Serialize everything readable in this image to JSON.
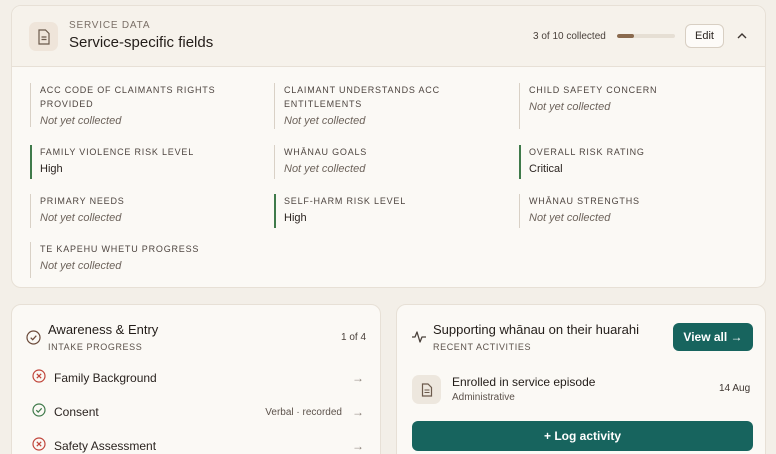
{
  "service_data": {
    "eyebrow": "SERVICE DATA",
    "title": "Service-specific fields",
    "progress_text": "3 of 10 collected",
    "progress_fraction": 0.3,
    "edit_label": "Edit",
    "fields": [
      {
        "label": "ACC CODE OF CLAIMANTS RIGHTS PROVIDED",
        "value": "Not yet collected"
      },
      {
        "label": "CLAIMANT UNDERSTANDS ACC ENTITLEMENTS",
        "value": "Not yet collected"
      },
      {
        "label": "CHILD SAFETY CONCERN",
        "value": "Not yet collected"
      },
      {
        "label": "FAMILY VIOLENCE RISK LEVEL",
        "value": "High"
      },
      {
        "label": "WHĀNAU GOALS",
        "value": "Not yet collected"
      },
      {
        "label": "OVERALL RISK RATING",
        "value": "Critical"
      },
      {
        "label": "PRIMARY NEEDS",
        "value": "Not yet collected"
      },
      {
        "label": "SELF-HARM RISK LEVEL",
        "value": "High"
      },
      {
        "label": "WHĀNAU STRENGTHS",
        "value": "Not yet collected"
      },
      {
        "label": "TE KAPEHU WHETU PROGRESS",
        "value": "Not yet collected"
      }
    ]
  },
  "intake": {
    "title": "Awareness & Entry",
    "subtitle": "INTAKE PROGRESS",
    "step_count": "1 of 4",
    "steps": [
      {
        "label": "Family Background",
        "status": "incomplete",
        "meta": ""
      },
      {
        "label": "Consent",
        "status": "complete",
        "meta": "Verbal · recorded"
      },
      {
        "label": "Safety Assessment",
        "status": "incomplete",
        "meta": ""
      }
    ]
  },
  "activity": {
    "title": "Supporting whānau on their huarahi",
    "subtitle": "RECENT ACTIVITIES",
    "view_all_label": "View all →",
    "items": [
      {
        "title": "Enrolled in service episode",
        "category": "Administrative",
        "date": "14 Aug"
      }
    ],
    "log_label": "+ Log activity"
  },
  "colors": {
    "accent": "#17645e",
    "risk_border": "#3f7a4a",
    "incomplete": "#c0453a",
    "complete": "#3f7a4a",
    "progress": "#8a6a4e"
  }
}
